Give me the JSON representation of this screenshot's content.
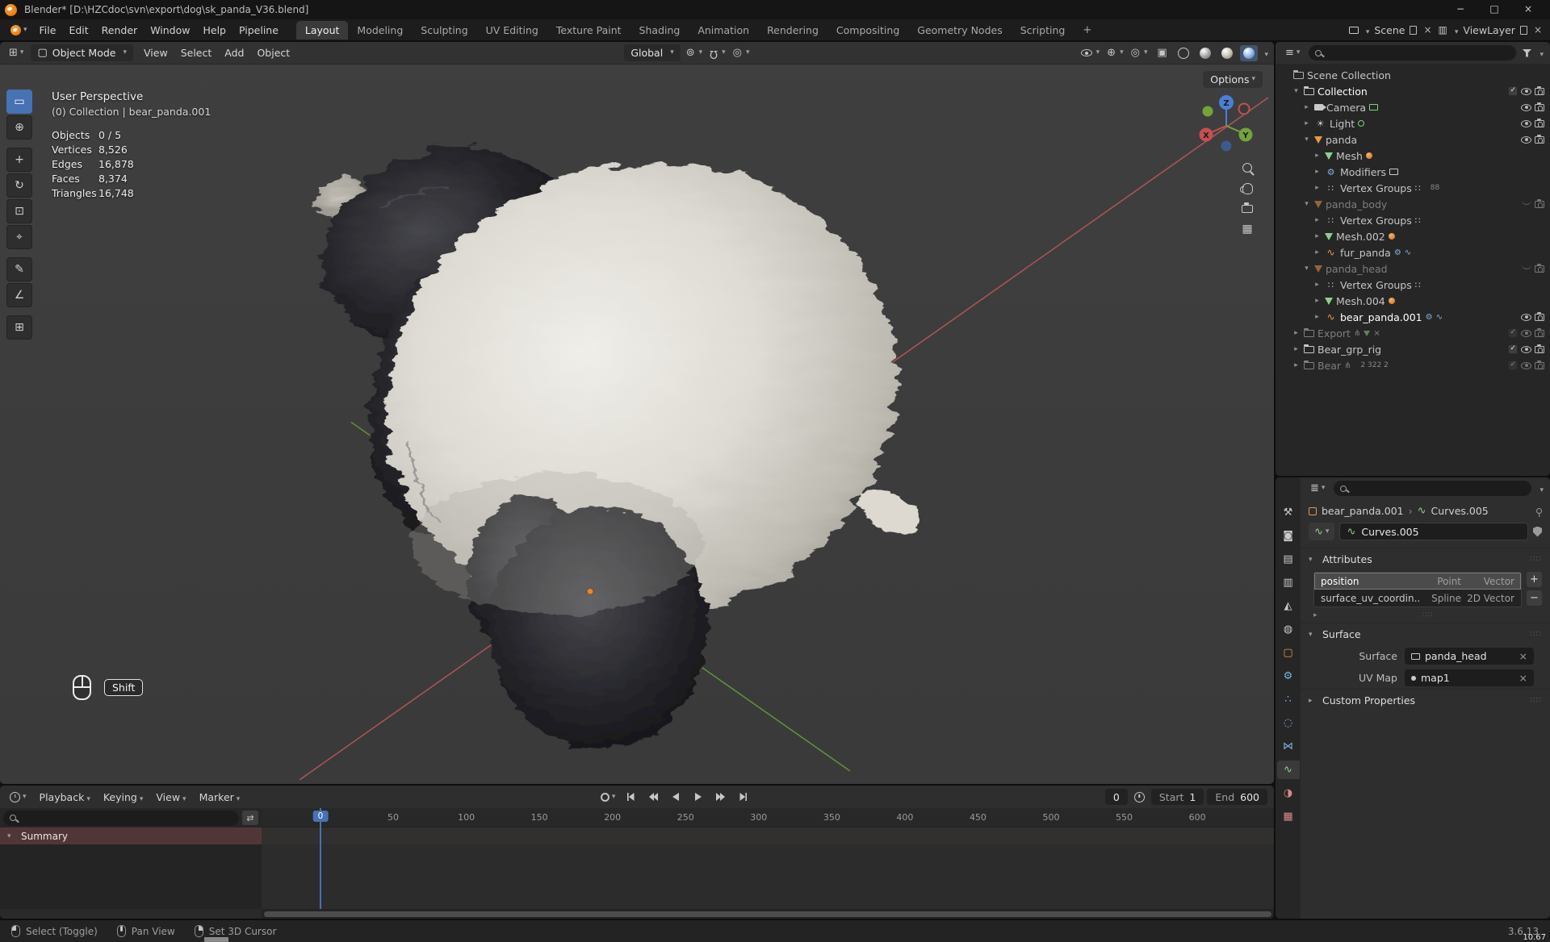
{
  "window": {
    "title": "Blender* [D:\\HZCdoc\\svn\\export\\dog\\sk_panda_V36.blend]",
    "minimize": "−",
    "maximize": "□",
    "close": "×"
  },
  "topbar": {
    "menus": [
      {
        "label": "File"
      },
      {
        "label": "Edit"
      },
      {
        "label": "Render"
      },
      {
        "label": "Window"
      },
      {
        "label": "Help"
      },
      {
        "label": "Pipeline"
      }
    ],
    "workspaces": [
      {
        "label": "Layout",
        "cls": "active"
      },
      {
        "label": "Modeling"
      },
      {
        "label": "Sculpting"
      },
      {
        "label": "UV Editing"
      },
      {
        "label": "Texture Paint"
      },
      {
        "label": "Shading"
      },
      {
        "label": "Animation"
      },
      {
        "label": "Rendering"
      },
      {
        "label": "Compositing"
      },
      {
        "label": "Geometry Nodes"
      },
      {
        "label": "Scripting"
      }
    ],
    "add_tab": "+",
    "scene_label": "Scene",
    "viewlayer_label": "ViewLayer"
  },
  "viewport": {
    "mode": "Object Mode",
    "menus": [
      {
        "label": "View"
      },
      {
        "label": "Select"
      },
      {
        "label": "Add"
      },
      {
        "label": "Object"
      }
    ],
    "orientation": "Global",
    "options": "Options",
    "overlay": {
      "view": "User Perspective",
      "context": "(0) Collection | bear_panda.001"
    },
    "stats": [
      {
        "label": "Objects",
        "value": "0 / 5"
      },
      {
        "label": "Vertices",
        "value": "8,526"
      },
      {
        "label": "Edges",
        "value": "16,878"
      },
      {
        "label": "Faces",
        "value": "8,374"
      },
      {
        "label": "Triangles",
        "value": "16,748"
      }
    ],
    "gizmo_axes": {
      "x": "X",
      "y": "Y",
      "z": "Z"
    },
    "hint_key": "Shift"
  },
  "toolbar": {
    "tools": [
      {
        "name": "tweak-select",
        "glyph": "▭",
        "cls": "active"
      },
      {
        "name": "cursor",
        "glyph": "⊕"
      },
      {
        "name": "move",
        "glyph": "+",
        "cls": "grp"
      },
      {
        "name": "rotate",
        "glyph": "↻"
      },
      {
        "name": "scale",
        "glyph": "⊡"
      },
      {
        "name": "transform",
        "glyph": "⌖"
      },
      {
        "name": "annotate",
        "glyph": "✎",
        "cls": "grp"
      },
      {
        "name": "measure",
        "glyph": "∠"
      },
      {
        "name": "add-cube",
        "glyph": "⊞",
        "cls": "grp"
      }
    ]
  },
  "outliner": {
    "rows": [
      {
        "ind": 0,
        "exp": "",
        "icon": "o-scenecol",
        "label": "Scene Collection",
        "cls": "",
        "chk": "",
        "eye": "",
        "cam": ""
      },
      {
        "ind": 1,
        "exp": "▾",
        "icon": "o-collection",
        "label": "Collection",
        "cls": "sel",
        "chk": "check-on",
        "eye": "eye-open",
        "cam": "cam-on"
      },
      {
        "ind": 2,
        "exp": "▸",
        "icon": "o-camera",
        "label": "Camera",
        "b1": "b-screen-g",
        "chk": "",
        "eye": "eye-open",
        "cam": "cam-on"
      },
      {
        "ind": 2,
        "exp": "▸",
        "icon": "o-light",
        "label": "Light",
        "b1": "b-ring-g",
        "chk": "",
        "eye": "eye-open",
        "cam": "cam-on"
      },
      {
        "ind": 2,
        "exp": "▾",
        "icon": "o-mesh-o",
        "label": "panda",
        "cls": "",
        "chk": "",
        "eye": "eye-open",
        "cam": "cam-on"
      },
      {
        "ind": 3,
        "exp": "▸",
        "icon": "o-mesh-g",
        "label": "Mesh",
        "b1": "b-dot-o"
      },
      {
        "ind": 3,
        "exp": "▸",
        "icon": "o-wrench",
        "label": "Modifiers",
        "b1": "b-screen"
      },
      {
        "ind": 3,
        "exp": "▸",
        "icon": "o-grid",
        "label": "Vertex Groups",
        "b1": "b-grid",
        "bt": "88"
      },
      {
        "ind": 2,
        "exp": "▾",
        "icon": "o-mesh-o",
        "label": "panda_body",
        "cls": "dim",
        "chk": "",
        "eye": "eye-closed",
        "cam": "cam-on"
      },
      {
        "ind": 3,
        "exp": "▸",
        "icon": "o-grid",
        "label": "Vertex Groups",
        "b1": "b-grid"
      },
      {
        "ind": 3,
        "exp": "▸",
        "icon": "o-mesh-g",
        "label": "Mesh.002",
        "b1": "b-dot-o"
      },
      {
        "ind": 3,
        "exp": "▸",
        "icon": "o-curve-o",
        "label": "fur_panda",
        "b1": "b-wrench",
        "b2": "b-curve"
      },
      {
        "ind": 2,
        "exp": "▾",
        "icon": "o-mesh-o",
        "label": "panda_head",
        "cls": "dim",
        "chk": "",
        "eye": "eye-closed",
        "cam": "cam-on"
      },
      {
        "ind": 3,
        "exp": "▸",
        "icon": "o-grid",
        "label": "Vertex Groups",
        "b1": "b-grid"
      },
      {
        "ind": 3,
        "exp": "▸",
        "icon": "o-mesh-g",
        "label": "Mesh.004",
        "b1": "b-dot-o"
      },
      {
        "ind": 3,
        "exp": "▸",
        "icon": "o-curve-o",
        "label": "bear_panda.001",
        "cls": "sel",
        "b1": "b-wrench",
        "b2": "b-curve",
        "eye": "eye-open",
        "cam": "cam-on"
      },
      {
        "ind": 1,
        "exp": "▸",
        "icon": "o-collection",
        "label": "Export",
        "cls": "dim",
        "b1": "b-bone",
        "b2": "b-tri",
        "b3": "b-x",
        "chk": "check-on",
        "eye": "eye-open",
        "cam": "cam-on"
      },
      {
        "ind": 1,
        "exp": "▸",
        "icon": "o-collection",
        "label": "Bear_grp_rig",
        "cls": "",
        "chk": "check-on",
        "eye": "eye-open",
        "cam": "cam-on"
      },
      {
        "ind": 1,
        "exp": "▸",
        "icon": "o-collection",
        "label": "Bear",
        "cls": "dim",
        "b1": "b-bone",
        "bt": "2 322 2",
        "chk": "check-on",
        "eye": "eye-open",
        "cam": "cam-on"
      }
    ]
  },
  "properties": {
    "breadcrumb": {
      "object": "bear_panda.001",
      "separator": "›",
      "data": "Curves.005"
    },
    "name_field": "Curves.005",
    "tabs": [
      {
        "name": "tool",
        "glyph": "⚒",
        "color": "#c9c9c9",
        "cls": ""
      },
      {
        "name": "render",
        "glyph": "◙",
        "color": "#c9c9c9",
        "cls": ""
      },
      {
        "name": "output",
        "glyph": "▤",
        "color": "#c9c9c9",
        "cls": ""
      },
      {
        "name": "view-layer",
        "glyph": "▥",
        "color": "#c9c9c9",
        "cls": ""
      },
      {
        "name": "scene",
        "glyph": "◭",
        "color": "#c9c9c9",
        "cls": ""
      },
      {
        "name": "world",
        "glyph": "◍",
        "color": "#c9c9c9",
        "cls": ""
      },
      {
        "name": "object",
        "glyph": "▢",
        "color": "#e9984a",
        "cls": ""
      },
      {
        "name": "modifiers",
        "glyph": "⚙",
        "color": "#7fb0e0",
        "cls": ""
      },
      {
        "name": "particles",
        "glyph": "∴",
        "color": "#7fb0e0",
        "cls": ""
      },
      {
        "name": "physics",
        "glyph": "◌",
        "color": "#7fb0e0",
        "cls": ""
      },
      {
        "name": "constraints",
        "glyph": "⋈",
        "color": "#7fb0e0",
        "cls": ""
      },
      {
        "name": "object-data",
        "glyph": "∿",
        "color": "#8fce8f",
        "cls": "active"
      },
      {
        "name": "material",
        "glyph": "◑",
        "color": "#d88a8a",
        "cls": ""
      },
      {
        "name": "texture",
        "glyph": "▦",
        "color": "#d88a8a",
        "cls": ""
      }
    ],
    "sections": {
      "attributes": {
        "title": "Attributes",
        "rows": [
          {
            "name": "position",
            "domain": "Point",
            "type": "Vector",
            "cls": "active"
          },
          {
            "name": "surface_uv_coordin...",
            "domain": "Spline",
            "type": "2D Vector",
            "cls": ""
          }
        ],
        "add": "+",
        "remove": "−"
      },
      "surface": {
        "title": "Surface",
        "fields": [
          {
            "label": "Surface",
            "value": "panda_head",
            "icon": "b-screen",
            "clear": "×"
          },
          {
            "label": "UV Map",
            "value": "map1",
            "icon": "g-dot",
            "clear": "×"
          }
        ]
      },
      "custom": {
        "title": "Custom Properties"
      }
    }
  },
  "timeline": {
    "menus": [
      {
        "label": "Playback"
      },
      {
        "label": "Keying"
      },
      {
        "label": "View"
      },
      {
        "label": "Marker"
      }
    ],
    "frame_current": "0",
    "start_label": "Start",
    "start_value": "1",
    "end_label": "End",
    "end_value": "600",
    "ruler": [
      "0",
      "50",
      "100",
      "150",
      "200",
      "250",
      "300",
      "350",
      "400",
      "450",
      "500",
      "550",
      "600"
    ],
    "playhead": "0",
    "summary": "Summary"
  },
  "statusbar": {
    "hints": [
      {
        "btn": "m-left",
        "label": "Select (Toggle)"
      },
      {
        "btn": "m-mid",
        "label": "Pan View"
      },
      {
        "btn": "m-right",
        "label": "Set 3D Cursor"
      }
    ],
    "version": "3.6.13"
  },
  "artifacts": {
    "corner_text": "10.67"
  },
  "colors": {
    "accent": "#4772b3",
    "object_orange": "#e9984a",
    "data_green": "#8fce8f",
    "modifier_blue": "#7fb0e0",
    "axis_x": "#b05050",
    "axis_y": "#5d8f3d",
    "axis_z": "#4a7fd6",
    "summary_channel": "#513638"
  }
}
